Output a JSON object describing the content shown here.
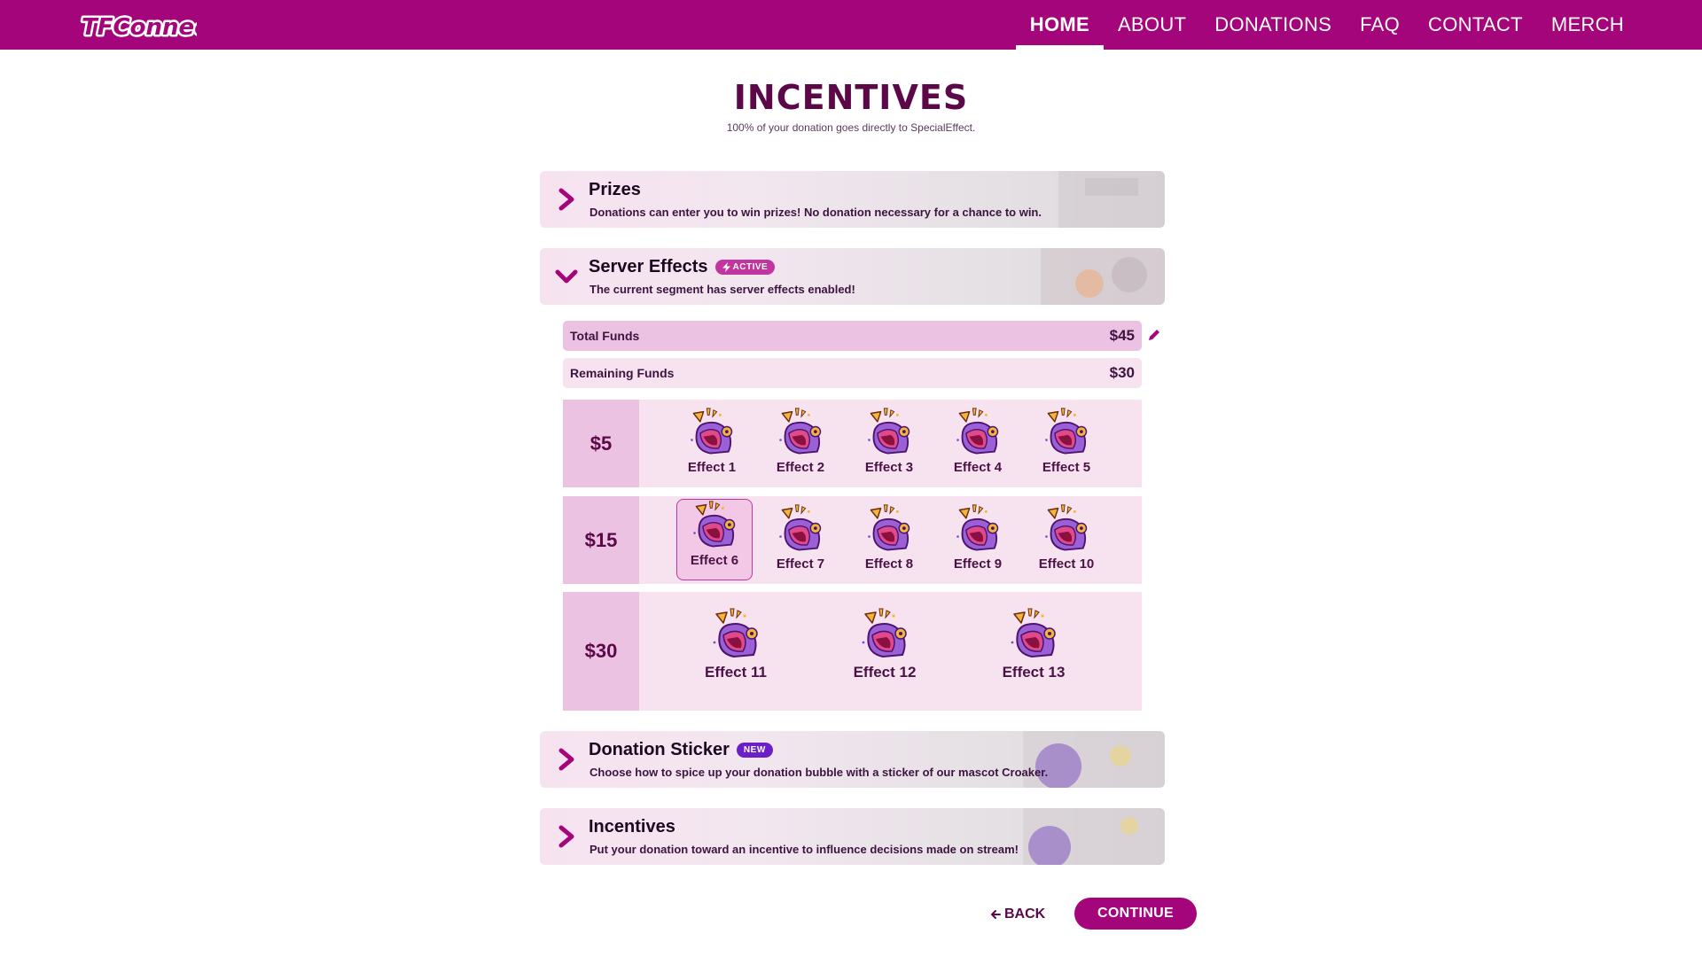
{
  "brand": {
    "logo_text": "TFConnect",
    "accent": "#a4057a",
    "tier_bg": "#f7e3f0",
    "tier_price_bg": "#ecc2e2"
  },
  "nav": {
    "items": [
      {
        "label": "HOME",
        "active": true
      },
      {
        "label": "ABOUT",
        "active": false
      },
      {
        "label": "DONATIONS",
        "active": false
      },
      {
        "label": "FAQ",
        "active": false
      },
      {
        "label": "CONTACT",
        "active": false
      },
      {
        "label": "MERCH",
        "active": false
      }
    ]
  },
  "page": {
    "title": "INCENTIVES",
    "subtitle": "100% of your donation goes directly to SpecialEffect."
  },
  "sections": {
    "prizes": {
      "title": "Prizes",
      "description": "Donations can enter you to win prizes! No donation necessary for a chance to win.",
      "expanded": false,
      "icon": "chevron-right-icon"
    },
    "server_effects": {
      "title": "Server Effects",
      "badge": "ACTIVE",
      "badge_icon": "lightning-icon",
      "description": "The current segment has server effects enabled!",
      "expanded": true,
      "icon": "chevron-down-icon"
    },
    "donation_sticker": {
      "title": "Donation Sticker",
      "badge": "NEW",
      "description": "Choose how to spice up your donation bubble with a sticker of our mascot Croaker.",
      "expanded": false,
      "icon": "chevron-right-icon"
    },
    "incentives": {
      "title": "Incentives",
      "description": "Put your donation toward an incentive to influence decisions made on stream!",
      "expanded": false,
      "icon": "chevron-right-icon"
    }
  },
  "funds": {
    "total_label": "Total Funds",
    "total_value": "$45",
    "remaining_label": "Remaining Funds",
    "remaining_value": "$30",
    "edit_icon": "pencil-icon"
  },
  "tiers": [
    {
      "price": "$5",
      "effects": [
        "Effect 1",
        "Effect 2",
        "Effect 3",
        "Effect 4",
        "Effect 5"
      ],
      "selected": null
    },
    {
      "price": "$15",
      "effects": [
        "Effect 6",
        "Effect 7",
        "Effect 8",
        "Effect 9",
        "Effect 10"
      ],
      "selected": "Effect 6"
    },
    {
      "price": "$30",
      "effects": [
        "Effect 11",
        "Effect 12",
        "Effect 13"
      ],
      "selected": null
    }
  ],
  "effect_icon": "shouting-mascot-icon",
  "actions": {
    "back_label": "BACK",
    "back_icon": "arrow-left-icon",
    "continue_label": "CONTINUE"
  }
}
